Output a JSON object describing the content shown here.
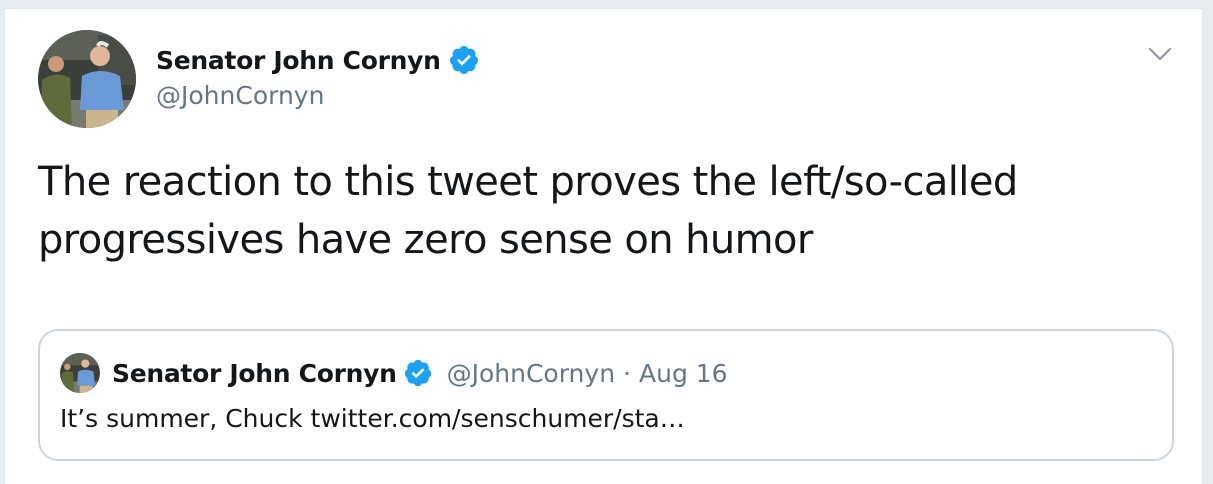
{
  "author": {
    "display_name": "Senator John Cornyn",
    "handle": "@JohnCornyn",
    "verified": true
  },
  "tweet": {
    "text": "The reaction to this tweet proves the left/so-called progressives have zero sense on humor"
  },
  "quoted_tweet": {
    "display_name": "Senator John Cornyn",
    "handle": "@JohnCornyn",
    "separator": "·",
    "date": "Aug 16",
    "text": "It’s summer, Chuck twitter.com/senschumer/sta…",
    "verified": true
  },
  "icons": {
    "verified": "verified-badge-icon",
    "menu": "chevron-down-icon"
  },
  "colors": {
    "verified_blue": "#1da1f2",
    "secondary_text": "#657786",
    "primary_text": "#14171a",
    "border": "#ccd6dd"
  }
}
